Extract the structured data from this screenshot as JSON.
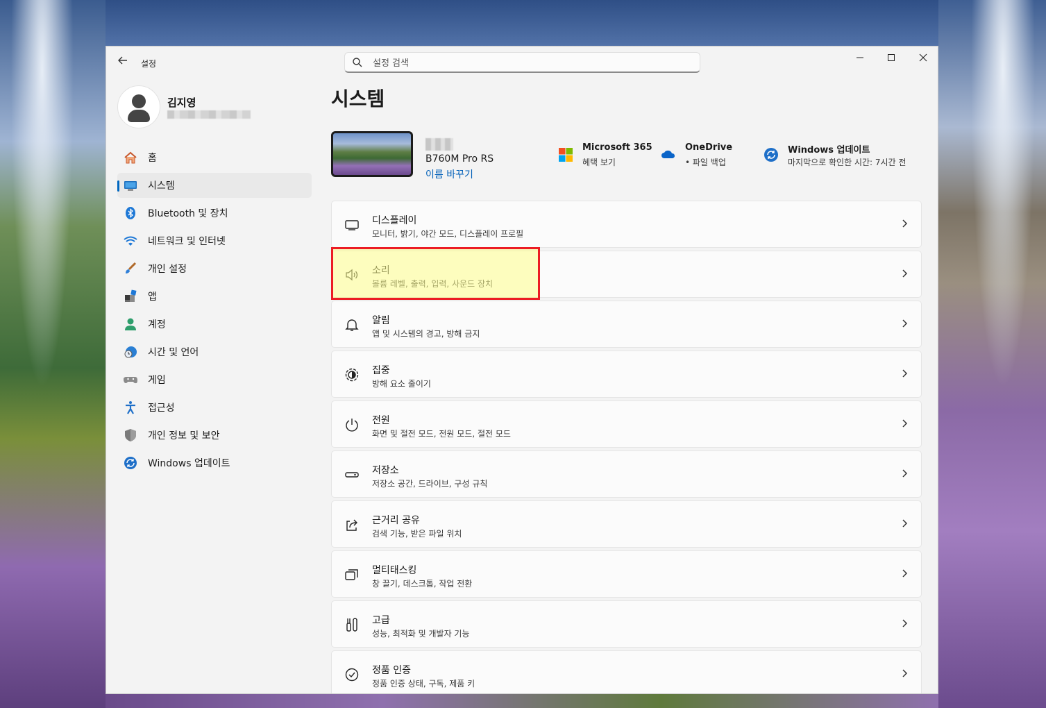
{
  "window": {
    "app_title": "설정"
  },
  "search": {
    "placeholder": "설정 검색"
  },
  "profile": {
    "name": "김지영"
  },
  "sidebar": {
    "items": [
      {
        "label": "홈",
        "icon": "home-icon"
      },
      {
        "label": "시스템",
        "icon": "system-icon",
        "active": true
      },
      {
        "label": "Bluetooth 및 장치",
        "icon": "bluetooth-icon"
      },
      {
        "label": "네트워크 및 인터넷",
        "icon": "wifi-icon"
      },
      {
        "label": "개인 설정",
        "icon": "paintbrush-icon"
      },
      {
        "label": "앱",
        "icon": "apps-icon"
      },
      {
        "label": "계정",
        "icon": "account-icon"
      },
      {
        "label": "시간 및 언어",
        "icon": "clock-globe-icon"
      },
      {
        "label": "게임",
        "icon": "gamepad-icon"
      },
      {
        "label": "접근성",
        "icon": "accessibility-icon"
      },
      {
        "label": "개인 정보 및 보안",
        "icon": "shield-icon"
      },
      {
        "label": "Windows 업데이트",
        "icon": "update-icon"
      }
    ]
  },
  "main": {
    "title": "시스템",
    "device": {
      "model": "B760M Pro RS",
      "rename_label": "이름 바꾸기"
    },
    "quick_links": [
      {
        "title": "Microsoft 365",
        "subtitle": "혜택 보기",
        "icon": "microsoft-logo-icon"
      },
      {
        "title": "OneDrive",
        "subtitle": "• 파일 백업",
        "icon": "onedrive-cloud-icon"
      },
      {
        "title": "Windows 업데이트",
        "subtitle": "마지막으로 확인한 시간: 7시간 전",
        "icon": "windows-update-icon"
      }
    ],
    "cards": [
      {
        "title": "디스플레이",
        "subtitle": "모니터, 밝기, 야간 모드, 디스플레이 프로필",
        "icon": "display-icon"
      },
      {
        "title": "소리",
        "subtitle": "볼륨 레벨, 출력, 입력, 사운드 장치",
        "icon": "speaker-icon"
      },
      {
        "title": "알림",
        "subtitle": "앱 및 시스템의 경고, 방해 금지",
        "icon": "bell-icon"
      },
      {
        "title": "집중",
        "subtitle": "방해 요소 줄이기",
        "icon": "focus-icon"
      },
      {
        "title": "전원",
        "subtitle": "화면 및 절전 모드, 전원 모드, 절전 모드",
        "icon": "power-icon"
      },
      {
        "title": "저장소",
        "subtitle": "저장소 공간, 드라이브, 구성 규칙",
        "icon": "storage-icon"
      },
      {
        "title": "근거리 공유",
        "subtitle": "검색 기능, 받은 파일 위치",
        "icon": "share-icon"
      },
      {
        "title": "멀티태스킹",
        "subtitle": "창 끌기, 데스크톱, 작업 전환",
        "icon": "multitasking-icon"
      },
      {
        "title": "고급",
        "subtitle": "성능, 최적화 및 개발자 기능",
        "icon": "tools-icon"
      },
      {
        "title": "정품 인증",
        "subtitle": "정품 인증 상태, 구독, 제품 키",
        "icon": "activation-check-icon"
      }
    ]
  },
  "colors": {
    "accent": "#0067c0",
    "link": "#005fb8",
    "highlight_border": "#ec1c24"
  }
}
